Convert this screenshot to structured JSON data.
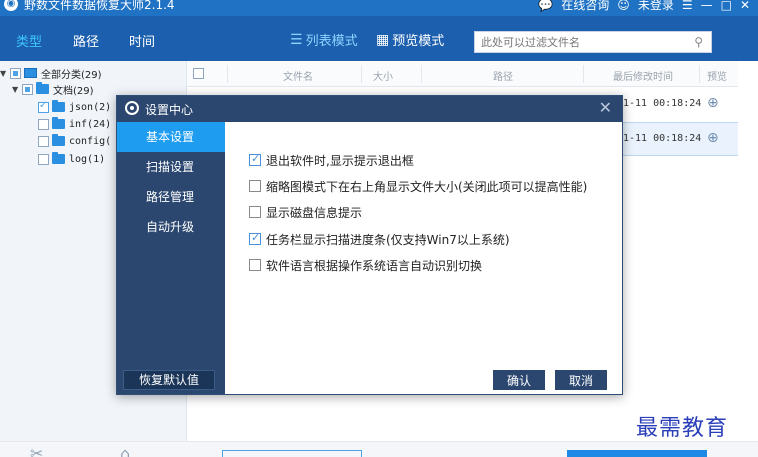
{
  "window": {
    "title": "野数文件数据恢复大师2.1.4",
    "right_items": [
      "在线咨询",
      "未登录"
    ]
  },
  "nav": {
    "tabs": [
      "类型",
      "路径",
      "时间"
    ],
    "active_tab": 0,
    "list_mode_label": "列表模式",
    "preview_mode_label": "预览模式",
    "filter_placeholder": "此处可以过滤文件名"
  },
  "tree": {
    "root_label": "全部分类(29)",
    "docs_label": "文档(29)",
    "children": [
      "json(2)",
      "inf(24)",
      "config(",
      "log(1)"
    ]
  },
  "list": {
    "columns": [
      "文件名",
      "大小",
      "路径",
      "最后修改时间",
      "预览"
    ],
    "rows": [
      {
        "time": "1-11 00:18:24"
      },
      {
        "time": "1-11 00:18:24"
      }
    ]
  },
  "dialog": {
    "title": "设置中心",
    "nav_items": [
      "基本设置",
      "扫描设置",
      "路径管理",
      "自动升级"
    ],
    "active_nav": 0,
    "options": [
      {
        "label": "退出软件时,显示提示退出框",
        "checked": true
      },
      {
        "label": "缩略图模式下在右上角显示文件大小(关闭此项可以提高性能)",
        "checked": false
      },
      {
        "label": "显示磁盘信息提示",
        "checked": false
      },
      {
        "label": "任务栏显示扫描进度条(仅支持Win7以上系统)",
        "checked": true
      },
      {
        "label": "软件语言根据操作系统语言自动识别切换",
        "checked": false
      }
    ],
    "restore_label": "恢复默认值",
    "ok_label": "确认",
    "cancel_label": "取消"
  },
  "watermark": "最需教育",
  "colors": {
    "titlebar": "#1f72c4",
    "navbar": "#1b5fae",
    "dialog_header": "#2b4770",
    "dialog_active": "#1e9cf0"
  }
}
